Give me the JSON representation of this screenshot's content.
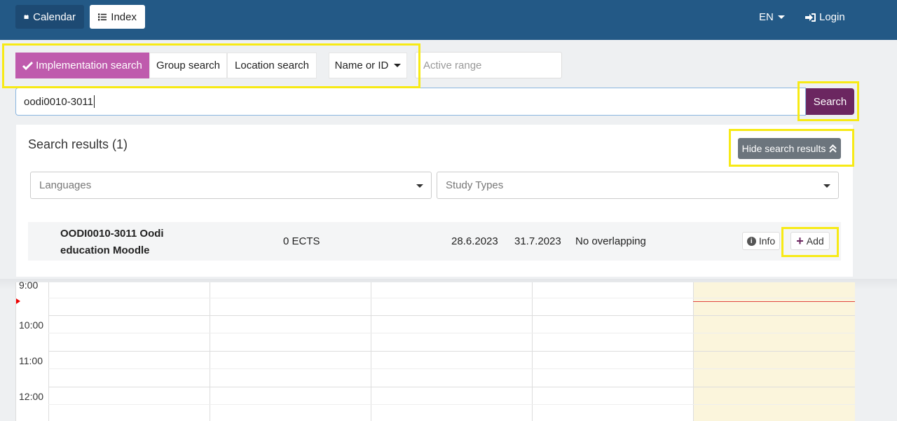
{
  "nav": {
    "calendar_label": "Calendar",
    "index_label": "Index",
    "language": "EN",
    "login_label": "Login"
  },
  "search": {
    "modes": [
      "Implementation search",
      "Group search",
      "Location search"
    ],
    "active_mode": "Implementation search",
    "field_selector": "Name or ID",
    "range_placeholder": "Active range",
    "query": "oodi0010-3011",
    "button_label": "Search"
  },
  "results": {
    "title": "Search results (1)",
    "hide_label": "Hide search results",
    "filters": {
      "languages_placeholder": "Languages",
      "study_types_placeholder": "Study Types"
    },
    "items": [
      {
        "name": "OODI0010-3011 Oodi education Moodle",
        "ects": "0 ECTS",
        "start": "28.6.2023",
        "end": "31.7.2023",
        "overlap": "No overlapping",
        "info_label": "Info",
        "add_label": "Add"
      }
    ]
  },
  "calendar": {
    "times": [
      "9:00",
      "10:00",
      "11:00",
      "12:00"
    ]
  },
  "colors": {
    "nav_bg": "#235986",
    "accent_pink": "#bf5bad",
    "search_button": "#6b2660",
    "highlight": "#f7ea15",
    "today_bg": "#fbf5dc"
  }
}
